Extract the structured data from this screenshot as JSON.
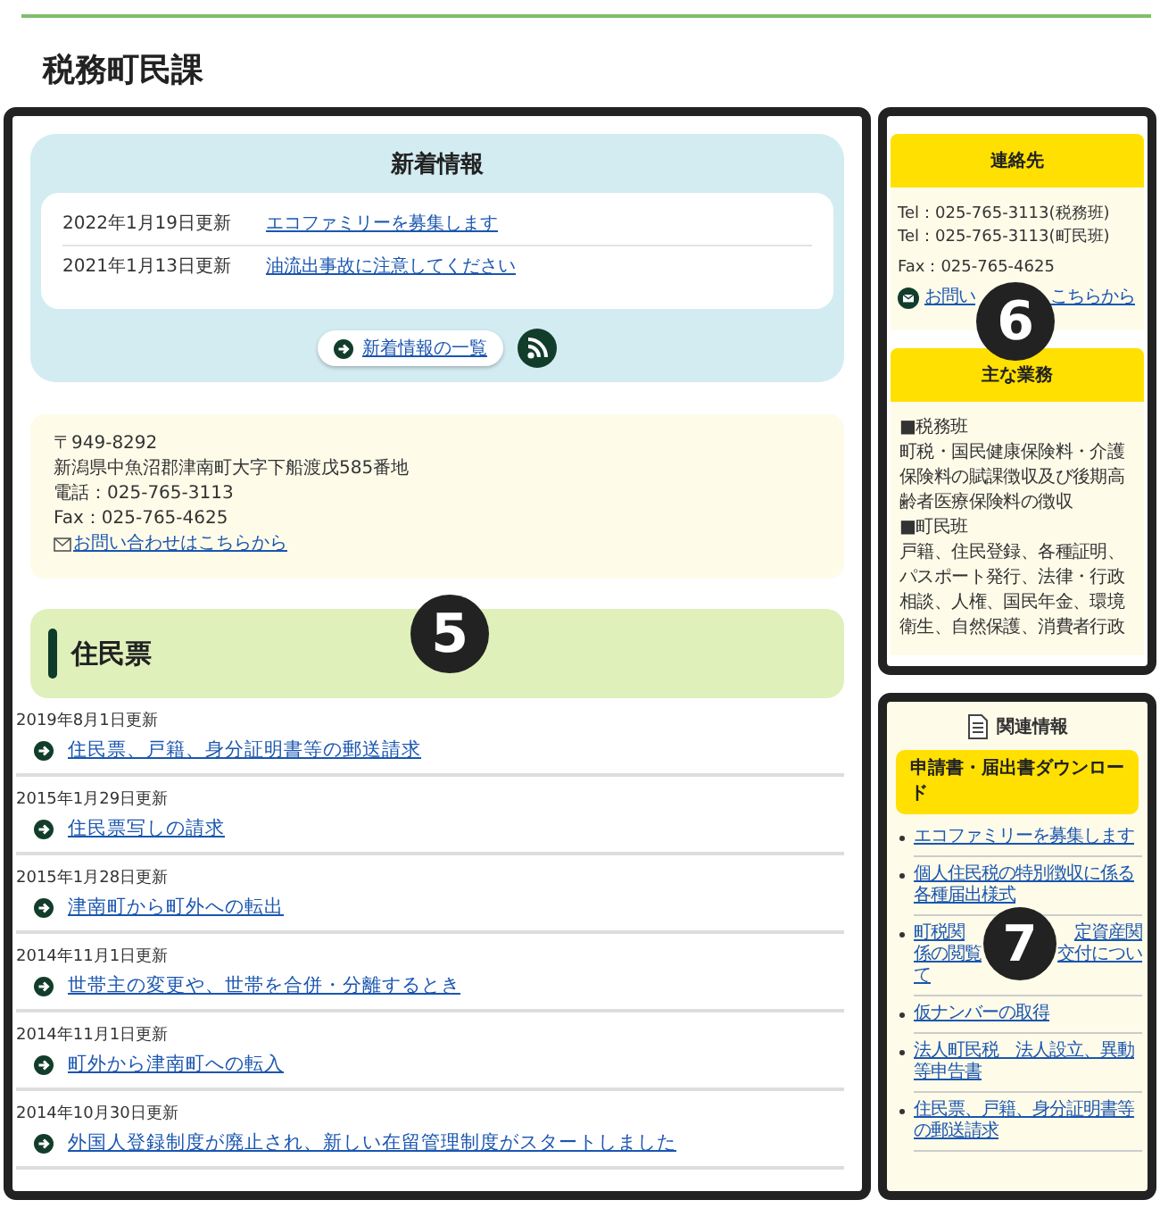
{
  "page_title": "税務町民課",
  "news": {
    "heading": "新着情報",
    "items": [
      {
        "date": "2022年1月19日更新",
        "title": "エコファミリーを募集します"
      },
      {
        "date": "2021年1月13日更新",
        "title": "油流出事故に注意してください"
      }
    ],
    "more_link": "新着情報の一覧"
  },
  "address": {
    "lines": [
      "〒949-8292",
      "新潟県中魚沼郡津南町大字下船渡戊585番地",
      "電話：025-765-3113",
      "Fax：025-765-4625"
    ],
    "contact_link": "お問い合わせはこちらから"
  },
  "section": {
    "heading": "住民票",
    "items": [
      {
        "date": "2019年8月1日更新",
        "title": "住民票、戸籍、身分証明書等の郵送請求"
      },
      {
        "date": "2015年1月29日更新",
        "title": "住民票写しの請求"
      },
      {
        "date": "2015年1月28日更新",
        "title": "津南町から町外への転出"
      },
      {
        "date": "2014年11月1日更新",
        "title": "世帯主の変更や、世帯を合併・分離するとき"
      },
      {
        "date": "2014年11月1日更新",
        "title": "町外から津南町への転入"
      },
      {
        "date": "2014年10月30日更新",
        "title": "外国人登録制度が廃止され、新しい在留管理制度がスタートしました"
      }
    ]
  },
  "contact": {
    "heading": "連絡先",
    "lines": [
      "Tel：025-765-3113(税務班)",
      "Tel：025-765-3113(町民班)"
    ],
    "fax": "Fax：025-765-4625",
    "link_segments": [
      "お問い",
      "こちらから"
    ]
  },
  "duties": {
    "heading": "主な業務",
    "lines": [
      "■税務班",
      "町税・国民健康保険料・介護保険料の賦課徴収及び後期高齢者医療保険料の徴収",
      "■町民班",
      "戸籍、住民登録、各種証明、パスポート発行、法律・行政相談、人権、国民年金、環境衛生、自然保護、消費者行政"
    ]
  },
  "related": {
    "heading": "関連情報",
    "category": "申請書・届出書ダウンロード",
    "links": [
      {
        "lines": [
          [
            "エコファミリーを募集します"
          ]
        ]
      },
      {
        "lines": [
          [
            "個人住民税の特別徴収に係る"
          ],
          [
            "各種届出様式"
          ]
        ]
      },
      {
        "lines": [
          [
            "町税関",
            "定資産関"
          ],
          [
            "係の閲覧",
            "交付につい"
          ],
          [
            "て"
          ]
        ]
      },
      {
        "lines": [
          [
            "仮ナンバーの取得"
          ]
        ]
      },
      {
        "lines": [
          [
            "法人町民税　法人設立、異動"
          ],
          [
            "等申告書"
          ]
        ]
      },
      {
        "lines": [
          [
            "住民票、戸籍、身分証明書等"
          ],
          [
            "の郵送請求"
          ]
        ]
      }
    ]
  },
  "annotations": [
    {
      "number": "5"
    },
    {
      "number": "6"
    },
    {
      "number": "7"
    }
  ]
}
